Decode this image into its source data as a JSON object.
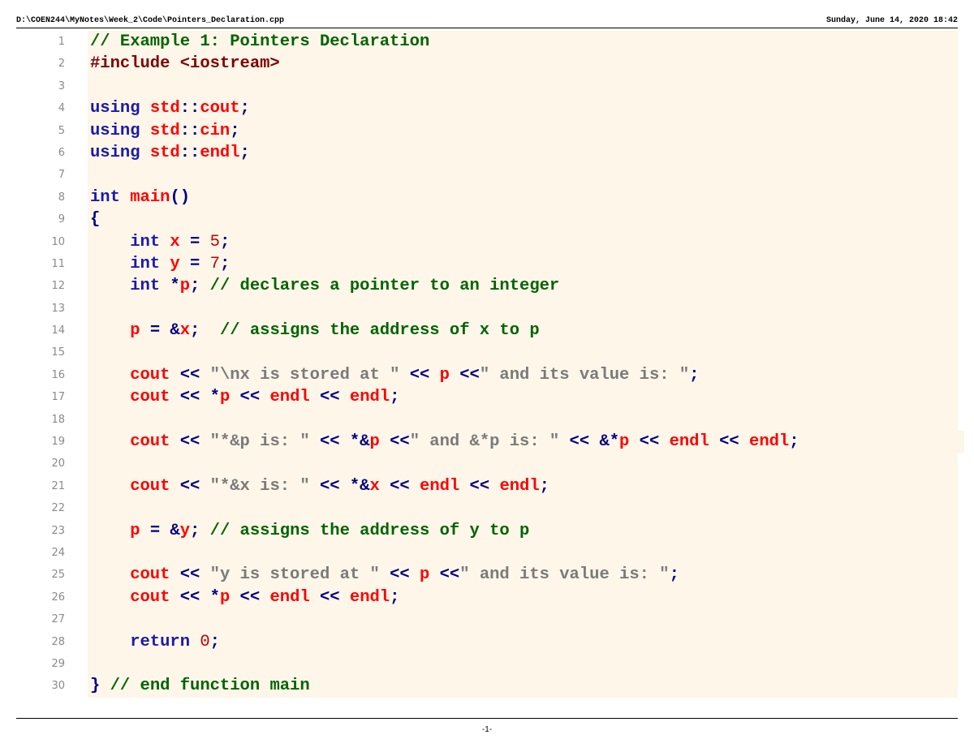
{
  "header": {
    "path": "D:\\COEN244\\MyNotes\\Week_2\\Code\\Pointers_Declaration.cpp",
    "date": "Sunday, June 14, 2020 18:42"
  },
  "lines": [
    {
      "n": "1",
      "tokens": [
        {
          "t": "// Example 1: Pointers Declaration",
          "c": "comment"
        }
      ]
    },
    {
      "n": "2",
      "tokens": [
        {
          "t": "#include <iostream>",
          "c": "pre"
        }
      ]
    },
    {
      "n": "3",
      "tokens": []
    },
    {
      "n": "4",
      "tokens": [
        {
          "t": "using ",
          "c": "kw"
        },
        {
          "t": "std",
          "c": "var"
        },
        {
          "t": "::",
          "c": "op"
        },
        {
          "t": "cout",
          "c": "var"
        },
        {
          "t": ";",
          "c": "op"
        }
      ]
    },
    {
      "n": "5",
      "tokens": [
        {
          "t": "using ",
          "c": "kw"
        },
        {
          "t": "std",
          "c": "var"
        },
        {
          "t": "::",
          "c": "op"
        },
        {
          "t": "cin",
          "c": "var"
        },
        {
          "t": ";",
          "c": "op"
        }
      ]
    },
    {
      "n": "6",
      "tokens": [
        {
          "t": "using ",
          "c": "kw"
        },
        {
          "t": "std",
          "c": "var"
        },
        {
          "t": "::",
          "c": "op"
        },
        {
          "t": "endl",
          "c": "var"
        },
        {
          "t": ";",
          "c": "op"
        }
      ]
    },
    {
      "n": "7",
      "tokens": []
    },
    {
      "n": "8",
      "tokens": [
        {
          "t": "int ",
          "c": "kw"
        },
        {
          "t": "main",
          "c": "var"
        },
        {
          "t": "()",
          "c": "op"
        }
      ]
    },
    {
      "n": "9",
      "tokens": [
        {
          "t": "{",
          "c": "op"
        }
      ]
    },
    {
      "n": "10",
      "tokens": [
        {
          "t": "    int ",
          "c": "kw"
        },
        {
          "t": "x",
          "c": "var"
        },
        {
          "t": " = ",
          "c": "op"
        },
        {
          "t": "5",
          "c": "num"
        },
        {
          "t": ";",
          "c": "op"
        }
      ]
    },
    {
      "n": "11",
      "tokens": [
        {
          "t": "    int ",
          "c": "kw"
        },
        {
          "t": "y",
          "c": "var"
        },
        {
          "t": " = ",
          "c": "op"
        },
        {
          "t": "7",
          "c": "num"
        },
        {
          "t": ";",
          "c": "op"
        }
      ]
    },
    {
      "n": "12",
      "tokens": [
        {
          "t": "    int ",
          "c": "kw"
        },
        {
          "t": "*",
          "c": "op"
        },
        {
          "t": "p",
          "c": "var"
        },
        {
          "t": "; ",
          "c": "op"
        },
        {
          "t": "// declares a pointer to an integer",
          "c": "comment"
        }
      ]
    },
    {
      "n": "13",
      "tokens": []
    },
    {
      "n": "14",
      "tokens": [
        {
          "t": "    p",
          "c": "var"
        },
        {
          "t": " = &",
          "c": "op"
        },
        {
          "t": "x",
          "c": "var"
        },
        {
          "t": ";  ",
          "c": "op"
        },
        {
          "t": "// assigns the address of x to p",
          "c": "comment"
        }
      ]
    },
    {
      "n": "15",
      "tokens": []
    },
    {
      "n": "16",
      "tokens": [
        {
          "t": "    cout",
          "c": "var"
        },
        {
          "t": " << ",
          "c": "op"
        },
        {
          "t": "\"\\nx is stored at \"",
          "c": "str"
        },
        {
          "t": " << ",
          "c": "op"
        },
        {
          "t": "p",
          "c": "var"
        },
        {
          "t": " <<",
          "c": "op"
        },
        {
          "t": "\" and its value is: \"",
          "c": "str"
        },
        {
          "t": ";",
          "c": "op"
        }
      ]
    },
    {
      "n": "17",
      "tokens": [
        {
          "t": "    cout",
          "c": "var"
        },
        {
          "t": " << *",
          "c": "op"
        },
        {
          "t": "p",
          "c": "var"
        },
        {
          "t": " << ",
          "c": "op"
        },
        {
          "t": "endl",
          "c": "var"
        },
        {
          "t": " << ",
          "c": "op"
        },
        {
          "t": "endl",
          "c": "var"
        },
        {
          "t": ";",
          "c": "op"
        }
      ]
    },
    {
      "n": "18",
      "tokens": []
    },
    {
      "n": "19",
      "wide": true,
      "tokens": [
        {
          "t": "    cout",
          "c": "var"
        },
        {
          "t": " << ",
          "c": "op"
        },
        {
          "t": "\"*&p is: \"",
          "c": "str"
        },
        {
          "t": " << *&",
          "c": "op"
        },
        {
          "t": "p",
          "c": "var"
        },
        {
          "t": " <<",
          "c": "op"
        },
        {
          "t": "\" and &*p is: \"",
          "c": "str"
        },
        {
          "t": " << &*",
          "c": "op"
        },
        {
          "t": "p",
          "c": "var"
        },
        {
          "t": " << ",
          "c": "op"
        },
        {
          "t": "endl",
          "c": "var"
        },
        {
          "t": " << ",
          "c": "op"
        },
        {
          "t": "endl",
          "c": "var"
        },
        {
          "t": ";",
          "c": "op"
        }
      ]
    },
    {
      "n": "20",
      "tokens": []
    },
    {
      "n": "21",
      "tokens": [
        {
          "t": "    cout",
          "c": "var"
        },
        {
          "t": " << ",
          "c": "op"
        },
        {
          "t": "\"*&x is: \"",
          "c": "str"
        },
        {
          "t": " << *&",
          "c": "op"
        },
        {
          "t": "x",
          "c": "var"
        },
        {
          "t": " << ",
          "c": "op"
        },
        {
          "t": "endl",
          "c": "var"
        },
        {
          "t": " << ",
          "c": "op"
        },
        {
          "t": "endl",
          "c": "var"
        },
        {
          "t": ";",
          "c": "op"
        }
      ]
    },
    {
      "n": "22",
      "tokens": []
    },
    {
      "n": "23",
      "tokens": [
        {
          "t": "    p",
          "c": "var"
        },
        {
          "t": " = &",
          "c": "op"
        },
        {
          "t": "y",
          "c": "var"
        },
        {
          "t": "; ",
          "c": "op"
        },
        {
          "t": "// assigns the address of y to p",
          "c": "comment"
        }
      ]
    },
    {
      "n": "24",
      "tokens": []
    },
    {
      "n": "25",
      "tokens": [
        {
          "t": "    cout",
          "c": "var"
        },
        {
          "t": " << ",
          "c": "op"
        },
        {
          "t": "\"y is stored at \"",
          "c": "str"
        },
        {
          "t": " << ",
          "c": "op"
        },
        {
          "t": "p",
          "c": "var"
        },
        {
          "t": " <<",
          "c": "op"
        },
        {
          "t": "\" and its value is: \"",
          "c": "str"
        },
        {
          "t": ";",
          "c": "op"
        }
      ]
    },
    {
      "n": "26",
      "tokens": [
        {
          "t": "    cout",
          "c": "var"
        },
        {
          "t": " << *",
          "c": "op"
        },
        {
          "t": "p",
          "c": "var"
        },
        {
          "t": " << ",
          "c": "op"
        },
        {
          "t": "endl",
          "c": "var"
        },
        {
          "t": " << ",
          "c": "op"
        },
        {
          "t": "endl",
          "c": "var"
        },
        {
          "t": ";",
          "c": "op"
        }
      ]
    },
    {
      "n": "27",
      "tokens": []
    },
    {
      "n": "28",
      "tokens": [
        {
          "t": "    return ",
          "c": "kw"
        },
        {
          "t": "0",
          "c": "num"
        },
        {
          "t": ";",
          "c": "op"
        }
      ]
    },
    {
      "n": "29",
      "tokens": []
    },
    {
      "n": "30",
      "tokens": [
        {
          "t": "} ",
          "c": "op"
        },
        {
          "t": "// end function main",
          "c": "comment"
        }
      ]
    }
  ],
  "footer": {
    "page": "-1-"
  }
}
